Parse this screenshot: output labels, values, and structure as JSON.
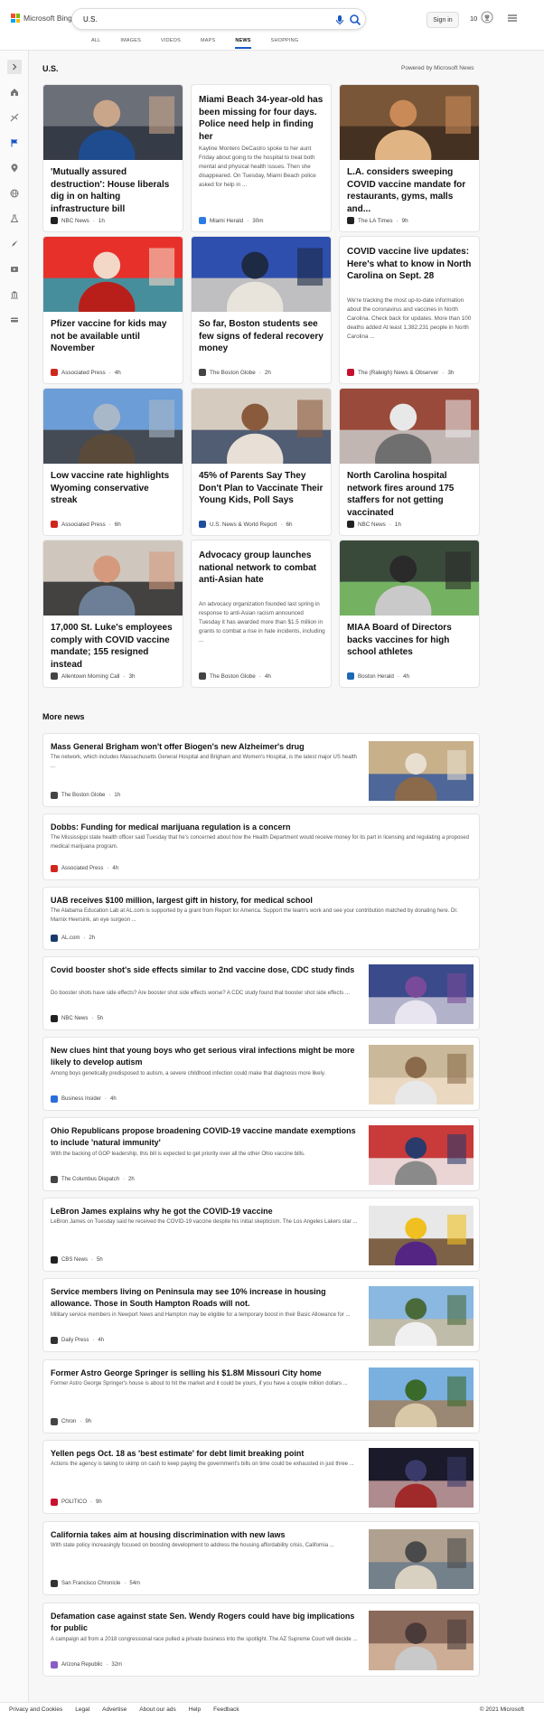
{
  "header": {
    "logo_text": "Microsoft Bing",
    "search_value": "U.S.",
    "signin": "Sign in",
    "rewards_count": "10"
  },
  "nav": [
    {
      "label": "ALL"
    },
    {
      "label": "IMAGES"
    },
    {
      "label": "VIDEOS"
    },
    {
      "label": "MAPS"
    },
    {
      "label": "NEWS"
    },
    {
      "label": "SHOPPING"
    }
  ],
  "sidebar_icons": [
    "collapse-chevron-icon",
    "home-icon",
    "sports-icon",
    "flag-icon",
    "location-pin-icon",
    "globe-icon",
    "science-icon",
    "rocket-icon",
    "video-icon",
    "politics-icon",
    "money-icon"
  ],
  "section": {
    "title": "U.S.",
    "powered_by": "Powered by Microsoft News"
  },
  "top_stories": [
    {
      "title": "'Mutually assured destruction': House liberals dig in on halting infrastructure bill",
      "snippet": "",
      "source": "NBC News",
      "time": "1h",
      "source_color": "#222222",
      "image": "woman-at-press-conference-photo"
    },
    {
      "title": "Miami Beach 34-year-old has been missing for four days. Police need help in finding her",
      "snippet": "Kayline Montero DeCastro spoke to her aunt Friday about going to the hospital to treat both mental and physical health issues. Then she disappeared. On Tuesday, Miami Beach police asked for help in ...",
      "source": "Miami Herald",
      "time": "30m",
      "source_color": "#2d7be5",
      "image": ""
    },
    {
      "title": "L.A. considers sweeping COVID vaccine mandate for restaurants, gyms, malls and...",
      "snippet": "",
      "source": "The LA Times",
      "time": "9h",
      "source_color": "#222222",
      "image": "restaurant-staff-photo"
    },
    {
      "title": "Pfizer vaccine for kids may not be available until November",
      "snippet": "",
      "source": "Associated Press",
      "time": "4h",
      "source_color": "#d0271d",
      "image": "vaccine-vials-photo"
    },
    {
      "title": "So far, Boston students see few signs of federal recovery money",
      "snippet": "",
      "source": "The Boston Globe",
      "time": "2h",
      "source_color": "#444444",
      "image": "students-in-classroom-photo"
    },
    {
      "title": "COVID vaccine live updates: Here's what to know in North Carolina on Sept. 28",
      "snippet": "We're tracking the most up-to-date information about the coronavirus and vaccines in North Carolina. Check back for updates. More than 100 deaths added At least 1,382,231 people in North Carolina ...",
      "source": "The (Raleigh) News & Observer",
      "time": "3h",
      "source_color": "#c8102e",
      "image": ""
    },
    {
      "title": "Low vaccine rate highlights Wyoming conservative streak",
      "snippet": "",
      "source": "Associated Press",
      "time": "6h",
      "source_color": "#d0271d",
      "image": "wyoming-street-photo"
    },
    {
      "title": "45% of Parents Say They Don't Plan to Vaccinate Their Young Kids, Poll Says",
      "snippet": "",
      "source": "U.S. News & World Report",
      "time": "6h",
      "source_color": "#1f4e9c",
      "image": "child-vaccination-photo"
    },
    {
      "title": "North Carolina hospital network fires around 175 staffers for not getting vaccinated",
      "snippet": "",
      "source": "NBC News",
      "time": "1h",
      "source_color": "#222222",
      "image": "hospital-building-photo"
    },
    {
      "title": "17,000 St. Luke's employees comply with COVID vaccine mandate; 155 resigned instead",
      "snippet": "",
      "source": "Allentown Morning Call",
      "time": "3h",
      "source_color": "#444444",
      "image": "nurse-vaccinating-photo"
    },
    {
      "title": "Advocacy group launches national network to combat anti-Asian hate",
      "snippet": "An advocacy organization founded last spring in response to anti-Asian racism announced Tuesday it has awarded more than $1.5 million in grants to combat a rise in hate incidents, including ...",
      "source": "The Boston Globe",
      "time": "4h",
      "source_color": "#444444",
      "image": ""
    },
    {
      "title": "MIAA Board of Directors backs vaccines for high school athletes",
      "snippet": "",
      "source": "Boston Herald",
      "time": "4h",
      "source_color": "#1b6ab3",
      "image": "stadium-health-worker-photo"
    }
  ],
  "more_news": {
    "title": "More news",
    "items": [
      {
        "title": "Mass General Brigham won't offer Biogen's new Alzheimer's drug",
        "snippet": "The network, which includes Massachusetts General Hospital and Brigham and Women's Hospital, is the latest major US health ...",
        "source": "The Boston Globe",
        "time": "1h",
        "source_color": "#444444",
        "image": "elderly-patient-photo"
      },
      {
        "title": "Dobbs: Funding for medical marijuana regulation is a concern",
        "snippet": "The Mississippi state health officer said Tuesday that he's concerned about how the Health Department would receive money for its part in licensing and regulating a proposed medical marijuana program.",
        "source": "Associated Press",
        "time": "4h",
        "source_color": "#d0271d",
        "image": ""
      },
      {
        "title": "UAB receives $100 million, largest gift in history, for medical school",
        "snippet": "The Alabama Education Lab at AL.com is supported by a grant from Report for America. Support the team's work and see your contribution matched by donating here. Dr. Marnix Heersink, an eye surgeon ...",
        "source": "AL.com",
        "time": "2h",
        "source_color": "#1a3b6b",
        "image": ""
      },
      {
        "title": "Covid booster shot's side effects similar to 2nd vaccine dose, CDC study finds",
        "snippet": "Do booster shots have side effects? Are booster shot side effects worse? A CDC study found that booster shot side effects ...",
        "source": "NBC News",
        "time": "5h",
        "source_color": "#222222",
        "image": "booster-shot-photo"
      },
      {
        "title": "New clues hint that young boys who get serious viral infections might be more likely to develop autism",
        "snippet": "Among boys genetically predisposed to autism, a severe childhood infection could make that diagnosis more likely.",
        "source": "Business Insider",
        "time": "4h",
        "source_color": "#2a6edb",
        "image": "boy-thermometer-photo"
      },
      {
        "title": "Ohio Republicans propose broadening COVID-19 vaccine mandate exemptions to include 'natural immunity'",
        "snippet": "With the backing of GOP leadership, this bill is expected to get priority over all the other Ohio vaccine bills.",
        "source": "The Columbus Dispatch",
        "time": "2h",
        "source_color": "#444444",
        "image": "protest-sign-photo"
      },
      {
        "title": "LeBron James explains why he got the COVID-19 vaccine",
        "snippet": "LeBron James on Tuesday said he received the COVID-19 vaccine despite his initial skepticism. The Los Angeles Lakers star ...",
        "source": "CBS News",
        "time": "5h",
        "source_color": "#222222",
        "image": "lebron-james-photo"
      },
      {
        "title": "Service members living on Peninsula may see 10% increase in housing allowance. Those in South Hampton Roads will not.",
        "snippet": "Military service members in Newport News and Hampton may be eligible for a temporary boost in their Basic Allowance for ...",
        "source": "Daily Press",
        "time": "4h",
        "source_color": "#333333",
        "image": "apartment-complex-photo"
      },
      {
        "title": "Former Astro George Springer is selling his $1.8M Missouri City home",
        "snippet": "Former Astro George Springer's house is about to hit the market and it could be yours, if you have a couple million dollars ...",
        "source": "Chron",
        "time": "9h",
        "source_color": "#444444",
        "image": "suburban-house-photo"
      },
      {
        "title": "Yellen pegs Oct. 18 as 'best estimate' for debt limit breaking point",
        "snippet": "Actions the agency is taking to skimp on cash to keep paying the government's bills on time could be exhausted in just three ...",
        "source": "POLITICO",
        "time": "9h",
        "source_color": "#c8102e",
        "image": "yellen-speaking-photo"
      },
      {
        "title": "California takes aim at housing discrimination with new laws",
        "snippet": "With state policy increasingly focused on boosting development to address the housing affordability crisis, California ...",
        "source": "San Francisco Chronicle",
        "time": "54m",
        "source_color": "#333333",
        "image": "city-street-photo"
      },
      {
        "title": "Defamation case against state Sen. Wendy Rogers could have big implications for public",
        "snippet": "A campaign ad from a 2018 congressional race pulled a private business into the spotlight. The AZ Supreme Court will decide ...",
        "source": "Arizona Republic",
        "time": "32m",
        "source_color": "#8a5cc4",
        "image": "wendy-rogers-photo"
      }
    ]
  },
  "footer": {
    "links": [
      "Privacy and Cookies",
      "Legal",
      "Advertise",
      "About our ads",
      "Help",
      "Feedback"
    ],
    "copyright": "© 2021 Microsoft"
  }
}
